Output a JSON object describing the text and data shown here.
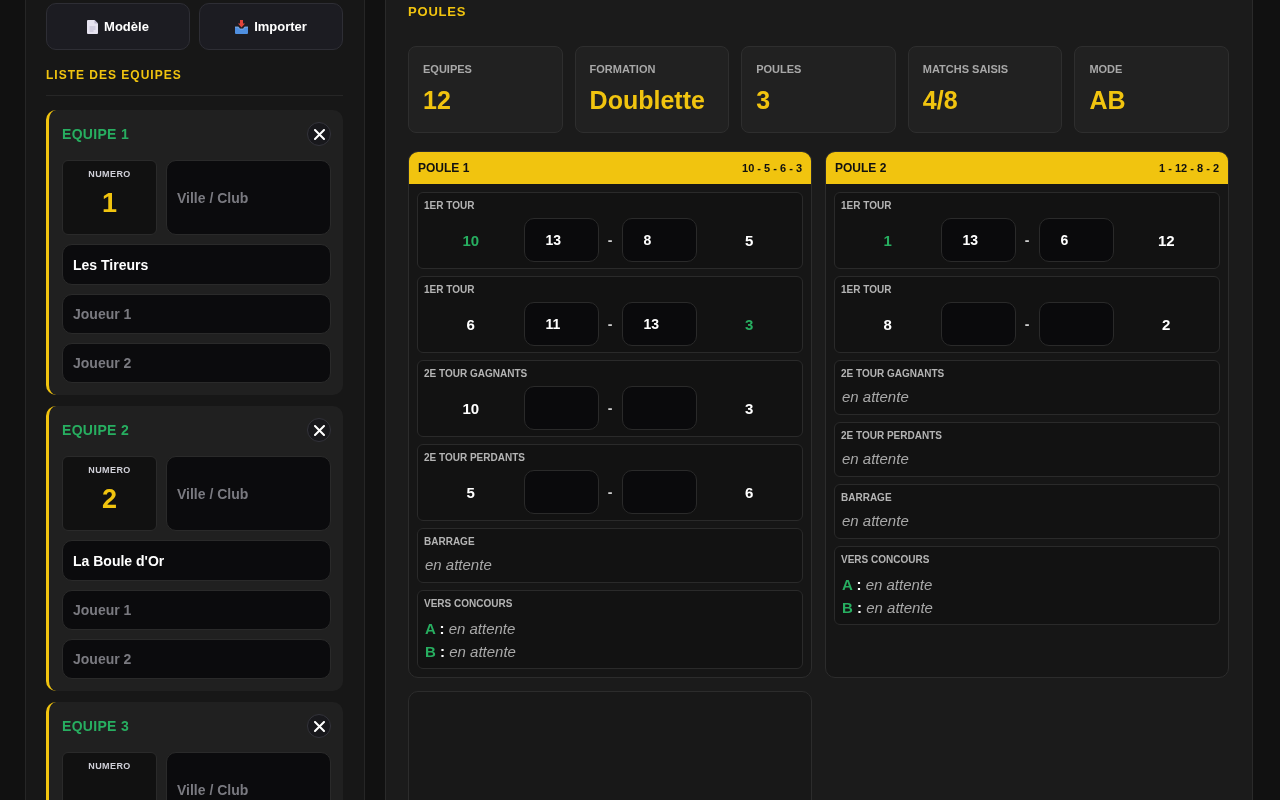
{
  "left_panel": {
    "buttons": [
      {
        "label": "Modèle"
      },
      {
        "label": "Importer"
      }
    ],
    "section_title": "LISTE DES EQUIPES",
    "teams": [
      {
        "title": "EQUIPE 1",
        "number_label": "NUMERO",
        "number": "1",
        "city": {
          "placeholder": "Ville / Club"
        },
        "name": {
          "value": "Les Tireurs"
        },
        "players": [
          {
            "placeholder": "Joueur 1"
          },
          {
            "placeholder": "Joueur 2"
          }
        ]
      },
      {
        "title": "EQUIPE 2",
        "number_label": "NUMERO",
        "number": "2",
        "city": {
          "placeholder": "Ville / Club"
        },
        "name": {
          "value": "La Boule d'Or"
        },
        "players": [
          {
            "placeholder": "Joueur 1"
          },
          {
            "placeholder": "Joueur 2"
          }
        ]
      },
      {
        "title": "EQUIPE 3",
        "number_label": "NUMERO",
        "city": {
          "placeholder": "Ville / Club"
        }
      }
    ]
  },
  "main": {
    "title": "POULES",
    "stats": [
      {
        "label": "EQUIPES",
        "value": "12"
      },
      {
        "label": "FORMATION",
        "value": "Doublette"
      },
      {
        "label": "POULES",
        "value": "3"
      },
      {
        "label": "MATCHS SAISIS",
        "value": "4/8"
      },
      {
        "label": "MODE",
        "value": "AB"
      }
    ],
    "poules": [
      {
        "kind": "filled",
        "title": "POULE 1",
        "teams": "10 - 5 - 6 - 3",
        "matches": [
          {
            "kind": "score",
            "label": "1ER TOUR",
            "team_a": {
              "number": "10",
              "winner": true
            },
            "score_a": "13",
            "separator": "-",
            "score_b": "8",
            "team_b": {
              "number": "5",
              "winner": false
            }
          },
          {
            "kind": "score",
            "label": "1ER TOUR",
            "team_a": {
              "number": "6",
              "winner": false
            },
            "score_a": "11",
            "separator": "-",
            "score_b": "13",
            "team_b": {
              "number": "3",
              "winner": true
            }
          },
          {
            "kind": "score",
            "label": "2E TOUR GAGNANTS",
            "team_a": {
              "number": "10",
              "winner": false
            },
            "separator": "-",
            "team_b": {
              "number": "3",
              "winner": false
            }
          },
          {
            "kind": "score",
            "label": "2E TOUR PERDANTS",
            "team_a": {
              "number": "5",
              "winner": false
            },
            "separator": "-",
            "team_b": {
              "number": "6",
              "winner": false
            }
          },
          {
            "kind": "pending",
            "label": "BARRAGE",
            "status": "en attente"
          },
          {
            "kind": "qualifiers",
            "label": "VERS CONCOURS",
            "lines": [
              "**A** : *en attente*",
              "**B** : *en attente*"
            ]
          }
        ]
      },
      {
        "kind": "filled",
        "title": "POULE 2",
        "teams": "1 - 12 - 8 - 2",
        "matches": [
          {
            "kind": "score",
            "label": "1ER TOUR",
            "team_a": {
              "number": "1",
              "winner": true
            },
            "score_a": "13",
            "separator": "-",
            "score_b": "6",
            "team_b": {
              "number": "12",
              "winner": false
            }
          },
          {
            "kind": "score",
            "label": "1ER TOUR",
            "team_a": {
              "number": "8",
              "winner": false
            },
            "separator": "-",
            "team_b": {
              "number": "2",
              "winner": false
            }
          },
          {
            "kind": "pending",
            "label": "2E TOUR GAGNANTS",
            "status": "en attente"
          },
          {
            "kind": "pending",
            "label": "2E TOUR PERDANTS",
            "status": "en attente"
          },
          {
            "kind": "pending",
            "label": "BARRAGE",
            "status": "en attente"
          },
          {
            "kind": "qualifiers",
            "label": "VERS CONCOURS",
            "lines": [
              "**A** : *en attente*",
              "**B** : *en attente*"
            ]
          }
        ]
      },
      {
        "kind": "blank"
      }
    ]
  }
}
